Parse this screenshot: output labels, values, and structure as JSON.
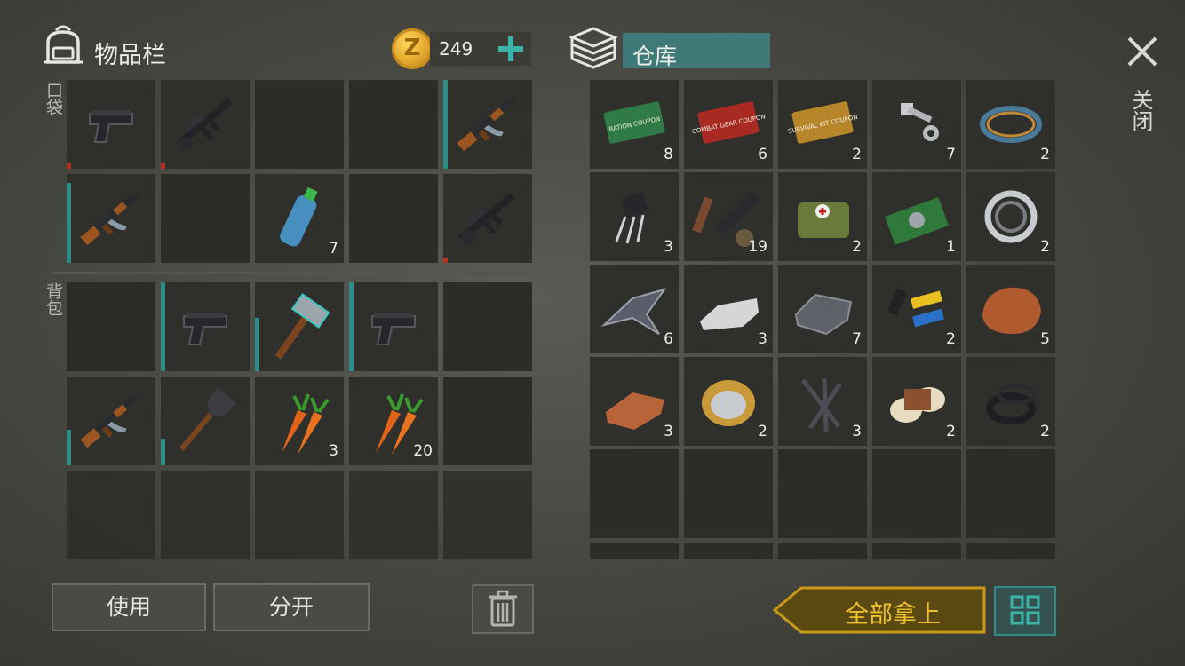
{
  "inventory": {
    "title": "物品栏",
    "coin_count": "249",
    "pocket_label": "口袋",
    "backpack_label": "背包"
  },
  "storage": {
    "title": "仓库"
  },
  "close_label": "关闭",
  "buttons": {
    "use": "使用",
    "split": "分开",
    "take_all": "全部拿上"
  },
  "colors": {
    "accent_teal": "#2e8c86",
    "gold": "#f0c030",
    "durability_low": "#b53021"
  },
  "pockets": [
    {
      "item": "pistol-icon",
      "count": "",
      "durability": 0.05
    },
    {
      "item": "assault-rifle-m4-icon",
      "count": "",
      "durability": 0.05
    },
    {
      "item": "",
      "count": ""
    },
    {
      "item": "",
      "count": ""
    },
    {
      "item": "ak-rifle-icon",
      "count": "",
      "durability": 1.0
    },
    {
      "item": "ak-rifle-icon",
      "count": "",
      "durability": 0.9
    },
    {
      "item": "",
      "count": ""
    },
    {
      "item": "water-bottle-icon",
      "count": "7"
    },
    {
      "item": "",
      "count": ""
    },
    {
      "item": "assault-rifle-m4-icon",
      "count": "",
      "durability": 0.05
    }
  ],
  "backpack": [
    {
      "item": "",
      "count": ""
    },
    {
      "item": "pistol-icon",
      "count": "",
      "durability": 1.0
    },
    {
      "item": "hammer-icon",
      "count": "",
      "durability": 0.6
    },
    {
      "item": "pistol-icon",
      "count": "",
      "durability": 1.0
    },
    {
      "item": "",
      "count": ""
    },
    {
      "item": "ak-rifle-icon",
      "count": "",
      "durability": 0.4
    },
    {
      "item": "shovel-icon",
      "count": "",
      "durability": 0.3
    },
    {
      "item": "carrot-icon",
      "count": "3"
    },
    {
      "item": "carrot-icon",
      "count": "20"
    },
    {
      "item": "",
      "count": ""
    }
  ],
  "storage_items": [
    {
      "item": "ration-coupon-icon",
      "count": "8",
      "text": "RATION COUPON"
    },
    {
      "item": "combat-gear-coupon-icon",
      "count": "6",
      "text": "COMBAT GEAR COUPON"
    },
    {
      "item": "survival-kit-coupon-icon",
      "count": "2",
      "text": "SURVIVAL KIT COUPON"
    },
    {
      "item": "bolt-nut-icon",
      "count": "7"
    },
    {
      "item": "wire-coil-icon",
      "count": "2"
    },
    {
      "item": "transistor-icon",
      "count": "3"
    },
    {
      "item": "scope-parts-icon",
      "count": "19"
    },
    {
      "item": "first-aid-bag-icon",
      "count": "2"
    },
    {
      "item": "circuit-board-icon",
      "count": "1"
    },
    {
      "item": "bearing-icon",
      "count": "2"
    },
    {
      "item": "metal-shards-icon",
      "count": "6"
    },
    {
      "item": "silver-ingot-icon",
      "count": "3"
    },
    {
      "item": "iron-ingot-icon",
      "count": "7"
    },
    {
      "item": "batteries-icon",
      "count": "2"
    },
    {
      "item": "copper-ore-icon",
      "count": "5"
    },
    {
      "item": "copper-ingot-icon",
      "count": "3"
    },
    {
      "item": "wire-spool-icon",
      "count": "2"
    },
    {
      "item": "nails-icon",
      "count": "3"
    },
    {
      "item": "bandage-roll-icon",
      "count": "2"
    },
    {
      "item": "rubber-rings-icon",
      "count": "2"
    }
  ]
}
